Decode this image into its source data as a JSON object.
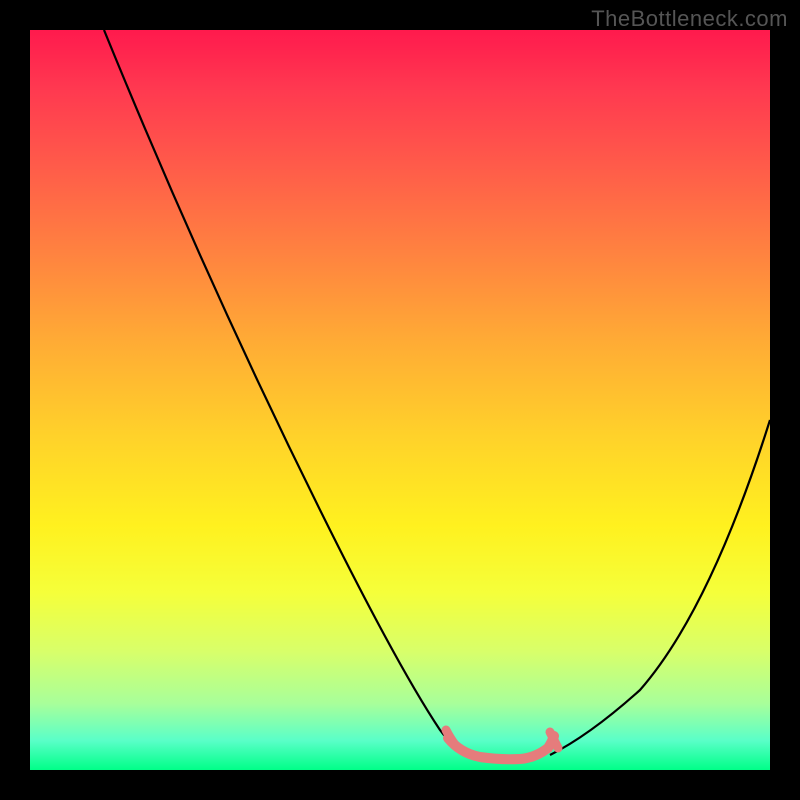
{
  "watermark": "TheBottleneck.com",
  "chart_data": {
    "type": "line",
    "title": "",
    "xlabel": "",
    "ylabel": "",
    "xlim": [
      0,
      100
    ],
    "ylim": [
      0,
      100
    ],
    "grid": false,
    "series": [
      {
        "name": "bottleneck-curve",
        "color": "#000000",
        "x": [
          10,
          20,
          30,
          40,
          50,
          55,
          58,
          62,
          66,
          70,
          80,
          90,
          100
        ],
        "y": [
          100,
          80,
          60,
          40,
          20,
          10,
          4,
          3,
          3,
          4,
          15,
          30,
          48
        ]
      },
      {
        "name": "sweet-spot-marker",
        "color": "#e57c7c",
        "x": [
          56,
          58,
          60,
          62,
          64,
          66,
          68,
          70
        ],
        "y": [
          6,
          4,
          3,
          3,
          3,
          3,
          4,
          6
        ]
      }
    ],
    "gradient_stops": [
      {
        "offset": 0,
        "color": "#ff1a4d"
      },
      {
        "offset": 8,
        "color": "#ff3950"
      },
      {
        "offset": 18,
        "color": "#ff5a4a"
      },
      {
        "offset": 30,
        "color": "#ff8240"
      },
      {
        "offset": 42,
        "color": "#ffab35"
      },
      {
        "offset": 55,
        "color": "#ffd22a"
      },
      {
        "offset": 67,
        "color": "#fff11f"
      },
      {
        "offset": 76,
        "color": "#f5ff3a"
      },
      {
        "offset": 84,
        "color": "#d8ff6a"
      },
      {
        "offset": 91,
        "color": "#a8ff9a"
      },
      {
        "offset": 96,
        "color": "#5affc8"
      },
      {
        "offset": 100,
        "color": "#00ff88"
      }
    ]
  }
}
